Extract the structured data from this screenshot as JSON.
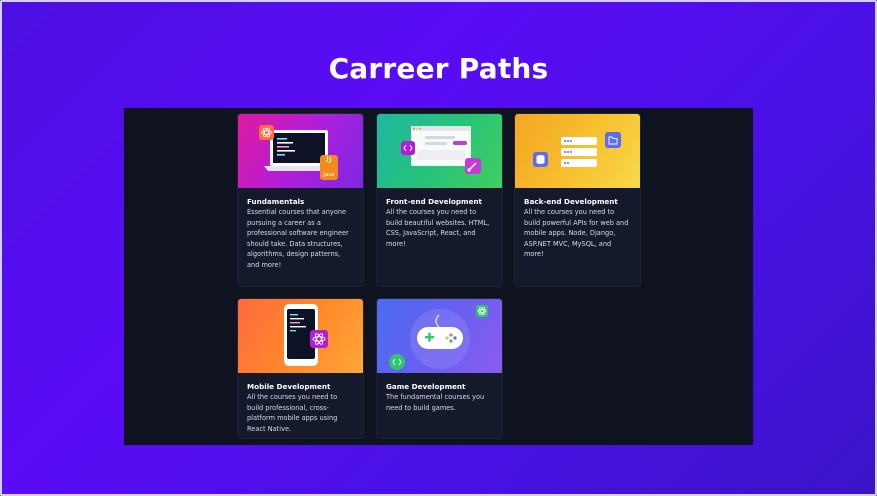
{
  "page": {
    "title": "Carreer Paths"
  },
  "cards": [
    {
      "title": "Fundamentals",
      "description": "Essential courses that anyone pursuing a career as a professional software engineer should take. Data structures, algorithms, design patterns, and more!"
    },
    {
      "title": "Front-end Development",
      "description": "All the courses you need to build beautiful websites. HTML, CSS, JavaScript, React, and more!"
    },
    {
      "title": "Back-end Development",
      "description": "All the courses you need to build powerful APIs for web and mobile apps. Node, Django, ASP.NET MVC, MySQL, and more!"
    },
    {
      "title": "Mobile Development",
      "description": "All the courses you need to build professional, cross-platform mobile apps using React Native."
    },
    {
      "title": "Game Development",
      "description": "The fundamental courses you need to build games."
    }
  ],
  "icons": {
    "card1": [
      "laptop-icon",
      "react-icon",
      "java-icon"
    ],
    "card2": [
      "browser-window-icon",
      "code-icon",
      "brush-icon"
    ],
    "card3": [
      "server-icon",
      "database-icon",
      "folder-icon"
    ],
    "card4": [
      "smartphone-icon",
      "react-icon"
    ],
    "card5": [
      "gamepad-icon",
      "code-icon",
      "react-icon"
    ]
  },
  "thumb_text": {
    "java": "Java"
  },
  "colors": {
    "background": "#5a0cf5",
    "panel": "#0f1320",
    "card": "#141a2c",
    "title_text": "#ffffff"
  }
}
